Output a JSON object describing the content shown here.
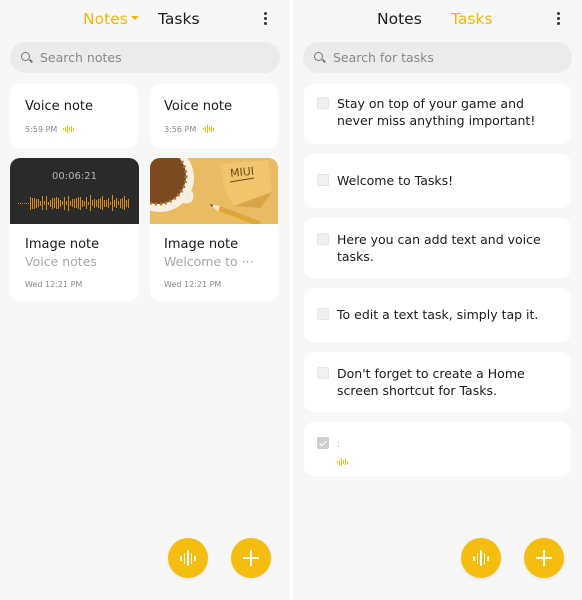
{
  "colors": {
    "accent": "#f2b705",
    "fab": "#f5bd0f",
    "background": "#f7f7f7",
    "card": "#ffffff"
  },
  "notes_screen": {
    "tabs": [
      {
        "label": "Notes",
        "active": true,
        "has_dropdown": true
      },
      {
        "label": "Tasks",
        "active": false
      }
    ],
    "more_icon": "more-vertical-icon",
    "search": {
      "placeholder": "Search notes",
      "icon": "search-icon"
    },
    "notes": [
      {
        "type": "voice",
        "title": "Voice note",
        "time": "5:59 PM",
        "icon": "audio-wave-icon"
      },
      {
        "type": "voice",
        "title": "Voice note",
        "time": "3:56 PM",
        "icon": "audio-wave-icon"
      },
      {
        "type": "image",
        "thumbnail": "audio-recording",
        "duration": "00:06:21",
        "title": "Image note",
        "preview": "Voice notes",
        "time": "Wed 12:21 PM"
      },
      {
        "type": "image",
        "thumbnail": "coffee-and-sticky-note",
        "sticky_text": "MIUI",
        "title": "Image note",
        "preview": "Welcome to ···",
        "time": "Wed 12:21 PM"
      }
    ],
    "fabs": [
      {
        "name": "voice-note-button",
        "icon": "audio-wave-icon"
      },
      {
        "name": "new-note-button",
        "icon": "plus-icon"
      }
    ]
  },
  "tasks_screen": {
    "tabs": [
      {
        "label": "Notes",
        "active": false
      },
      {
        "label": "Tasks",
        "active": true
      }
    ],
    "more_icon": "more-vertical-icon",
    "search": {
      "placeholder": "Search for tasks",
      "icon": "search-icon"
    },
    "tasks": [
      {
        "text": "Stay on top of your game and never miss anything important!",
        "done": false
      },
      {
        "text": "Welcome to Tasks!",
        "done": false
      },
      {
        "text": "Here you can add text and voice tasks.",
        "done": false
      },
      {
        "text": "To edit a text task, simply tap it.",
        "done": false
      },
      {
        "text": "Don't forget to create a Home screen shortcut for Tasks.",
        "done": false
      },
      {
        "text": ":",
        "done": true,
        "voice": true,
        "icon": "audio-wave-icon"
      }
    ],
    "fabs": [
      {
        "name": "voice-task-button",
        "icon": "audio-wave-icon"
      },
      {
        "name": "new-task-button",
        "icon": "plus-icon"
      }
    ]
  }
}
